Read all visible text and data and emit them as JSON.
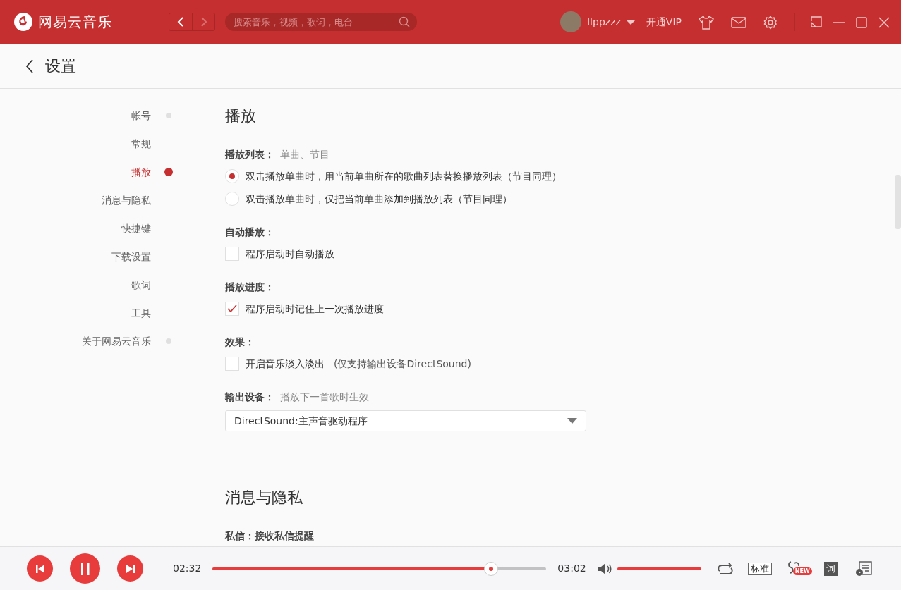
{
  "app": {
    "name": "网易云音乐"
  },
  "search": {
    "placeholder": "搜索音乐，视频，歌词，电台"
  },
  "user": {
    "name": "llppzzz",
    "vip": "开通VIP"
  },
  "page_title": "设置",
  "nav": [
    {
      "label": "帐号",
      "selected": false
    },
    {
      "label": "常规",
      "selected": false
    },
    {
      "label": "播放",
      "selected": true
    },
    {
      "label": "消息与隐私",
      "selected": false
    },
    {
      "label": "快捷键",
      "selected": false
    },
    {
      "label": "下载设置",
      "selected": false
    },
    {
      "label": "歌词",
      "selected": false
    },
    {
      "label": "工具",
      "selected": false
    },
    {
      "label": "关于网易云音乐",
      "selected": false
    }
  ],
  "sections": [
    {
      "title": "播放",
      "groups": [
        {
          "label": "播放列表：",
          "hint": "单曲、节目",
          "options": [
            {
              "kind": "radio",
              "text": "双击播放单曲时，用当前单曲所在的歌曲列表替换播放列表（节目同理）",
              "checked": true
            },
            {
              "kind": "radio",
              "text": "双击播放单曲时，仅把当前单曲添加到播放列表（节目同理）",
              "checked": false
            }
          ]
        },
        {
          "label": "自动播放：",
          "options": [
            {
              "kind": "checkbox",
              "text": "程序启动时自动播放",
              "checked": false
            }
          ]
        },
        {
          "label": "播放进度：",
          "options": [
            {
              "kind": "checkbox",
              "text": "程序启动时记住上一次播放进度",
              "checked": true
            }
          ]
        },
        {
          "label": "效果：",
          "options": [
            {
              "kind": "checkbox",
              "text": "开启音乐淡入淡出",
              "note": "(仅支持输出设备DirectSound)",
              "checked": false
            }
          ]
        },
        {
          "label": "输出设备：",
          "hint": "播放下一首歌时生效",
          "options": [
            {
              "kind": "select",
              "value": "DirectSound:主声音驱动程序"
            }
          ]
        }
      ]
    },
    {
      "title": "消息与隐私",
      "groups": [
        {
          "label": "私信：接收私信提醒"
        }
      ]
    }
  ],
  "player": {
    "elapsed": "02:32",
    "total": "03:02",
    "progress": {
      "level": 0.835
    },
    "volume": {
      "level": 1.0
    },
    "quality": "标准",
    "lyrics": "词",
    "badge": "NEW"
  }
}
